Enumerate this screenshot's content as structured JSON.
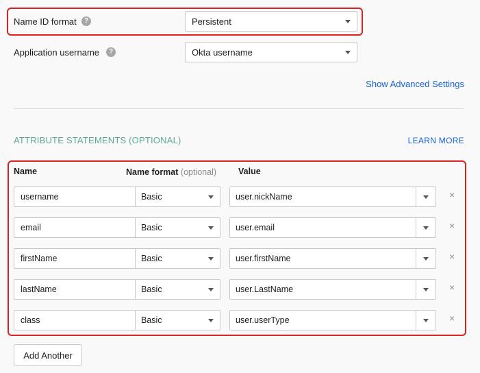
{
  "settings": {
    "name_id_format": {
      "label": "Name ID format",
      "help": "?",
      "value": "Persistent"
    },
    "application_username": {
      "label": "Application username",
      "help": "?",
      "value": "Okta username"
    },
    "advanced_link": "Show Advanced Settings"
  },
  "attributes": {
    "title": "ATTRIBUTE STATEMENTS (OPTIONAL)",
    "learn_more": "LEARN MORE",
    "headers": {
      "name": "Name",
      "name_format": "Name format",
      "optional": "(optional)",
      "value": "Value"
    },
    "rows": [
      {
        "name": "username",
        "format": "Basic",
        "value": "user.nickName"
      },
      {
        "name": "email",
        "format": "Basic",
        "value": "user.email"
      },
      {
        "name": "firstName",
        "format": "Basic",
        "value": "user.firstName"
      },
      {
        "name": "lastName",
        "format": "Basic",
        "value": "user.LastName"
      },
      {
        "name": "class",
        "format": "Basic",
        "value": "user.userType"
      }
    ],
    "remove_glyph": "×",
    "add_another": "Add Another"
  },
  "colors": {
    "highlight": "#e02020",
    "section_title": "#5ba88f",
    "link": "#1662dd"
  }
}
